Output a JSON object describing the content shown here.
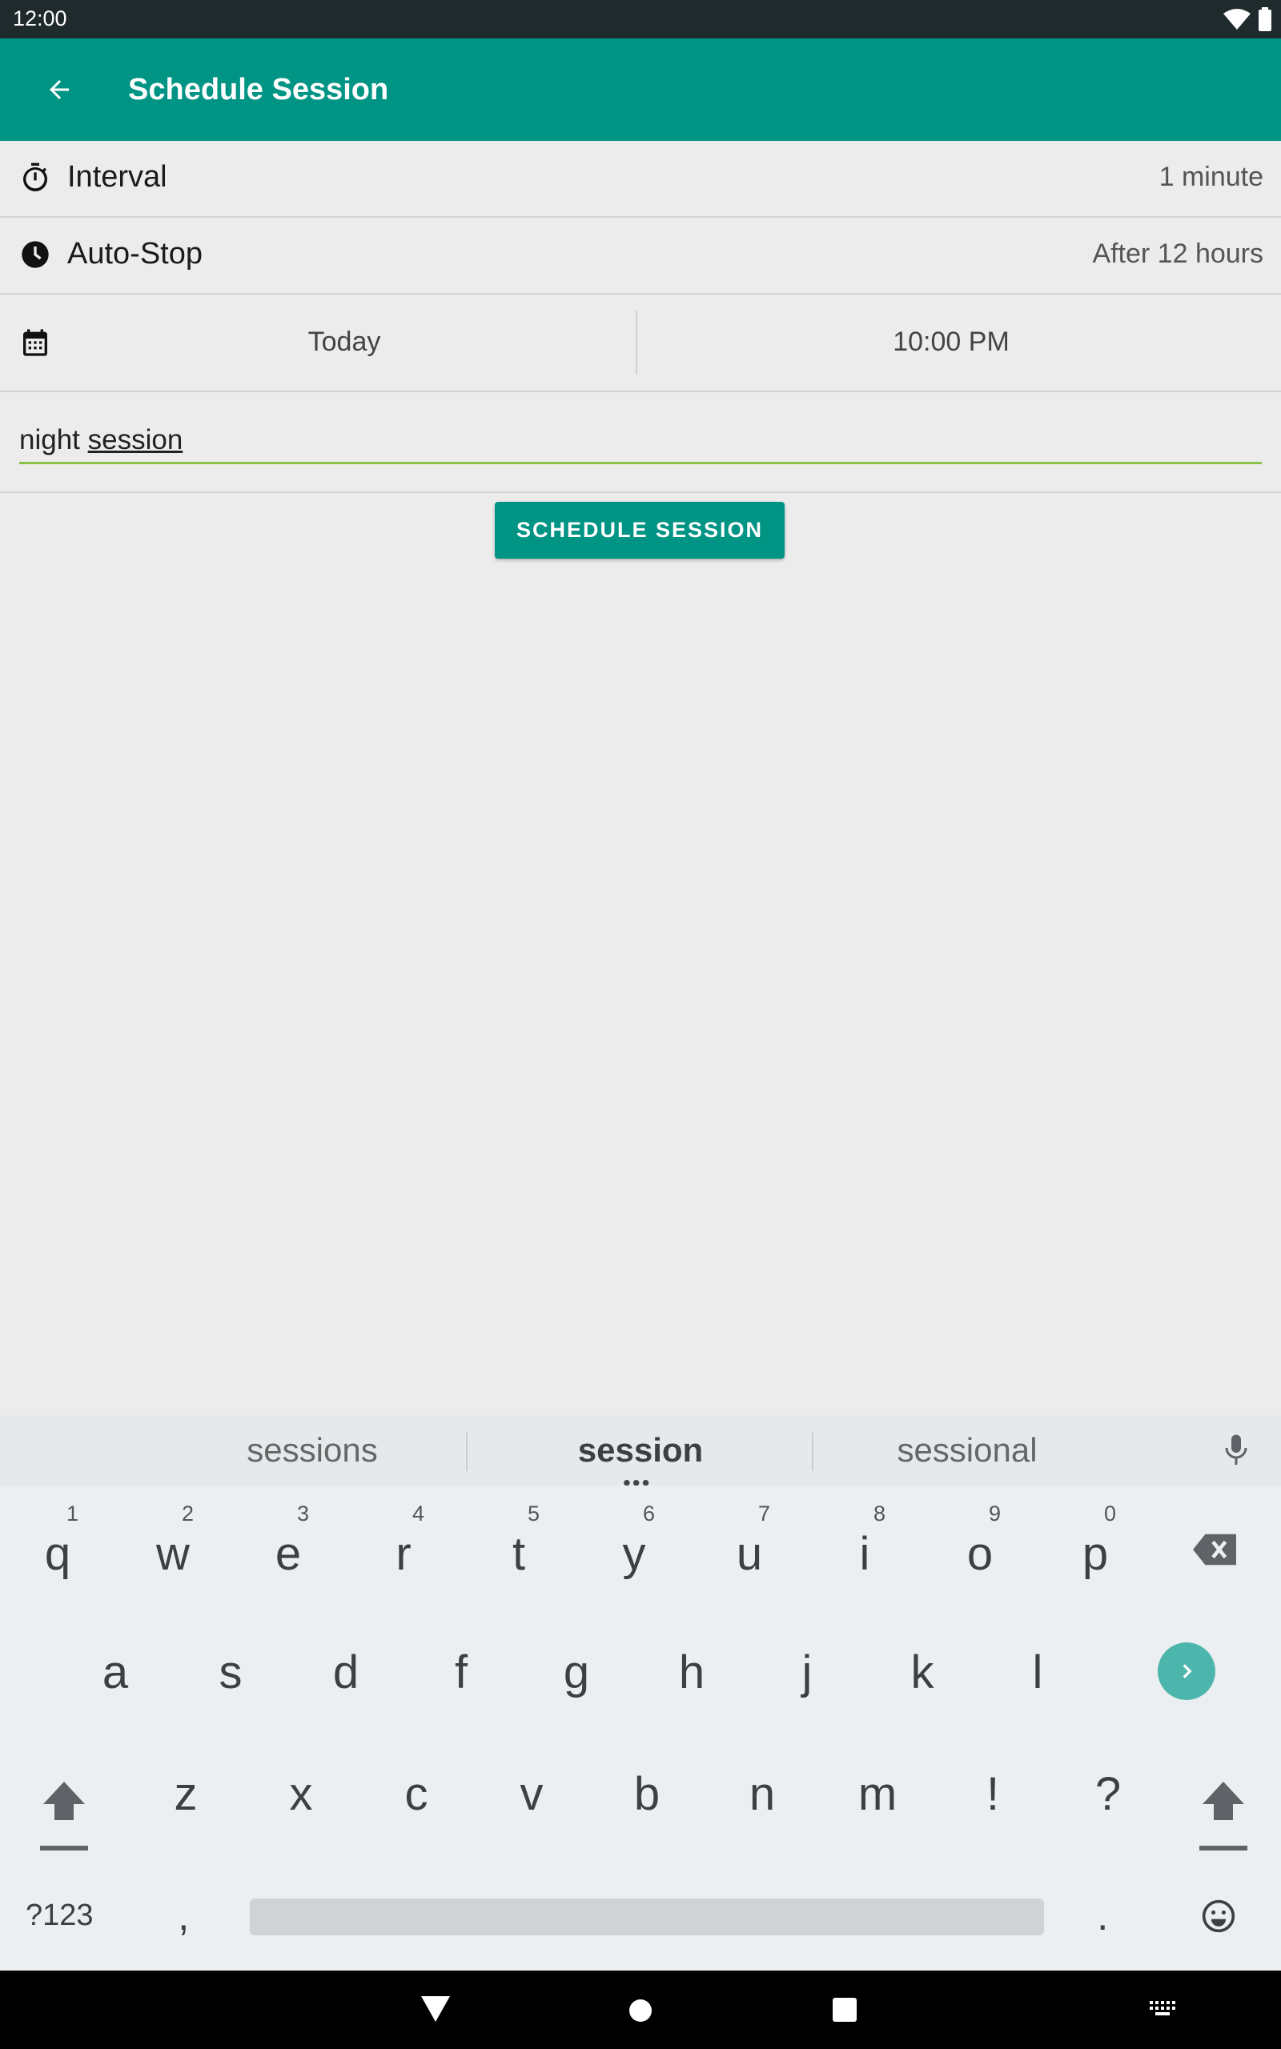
{
  "status_bar": {
    "time": "12:00"
  },
  "app_bar": {
    "title": "Schedule Session"
  },
  "settings": {
    "interval_label": "Interval",
    "interval_value": "1 minute",
    "autostop_label": "Auto-Stop",
    "autostop_value": "After 12 hours",
    "date_value": "Today",
    "time_value": "10:00 PM"
  },
  "name_field": {
    "value_plain": "night ",
    "value_composing": "session"
  },
  "actions": {
    "schedule_button": "SCHEDULE SESSION"
  },
  "keyboard": {
    "suggestions": [
      "sessions",
      "session",
      "sessional"
    ],
    "row1": [
      {
        "key": "q",
        "hint": "1"
      },
      {
        "key": "w",
        "hint": "2"
      },
      {
        "key": "e",
        "hint": "3"
      },
      {
        "key": "r",
        "hint": "4"
      },
      {
        "key": "t",
        "hint": "5"
      },
      {
        "key": "y",
        "hint": "6"
      },
      {
        "key": "u",
        "hint": "7"
      },
      {
        "key": "i",
        "hint": "8"
      },
      {
        "key": "o",
        "hint": "9"
      },
      {
        "key": "p",
        "hint": "0"
      }
    ],
    "row2": [
      "a",
      "s",
      "d",
      "f",
      "g",
      "h",
      "j",
      "k",
      "l"
    ],
    "row3": [
      "z",
      "x",
      "c",
      "v",
      "b",
      "n",
      "m",
      "!",
      "?"
    ],
    "symbols_key": "?123",
    "comma_key": ",",
    "period_key": "."
  },
  "colors": {
    "primary": "#009485",
    "accent": "#8bc34a"
  },
  "icons": [
    "back-arrow-icon",
    "stopwatch-icon",
    "clock-icon",
    "calendar-icon",
    "mic-icon",
    "backspace-icon",
    "next-icon",
    "shift-icon",
    "emoji-icon",
    "back-nav-icon",
    "home-nav-icon",
    "recents-nav-icon",
    "keyboard-switch-icon"
  ]
}
